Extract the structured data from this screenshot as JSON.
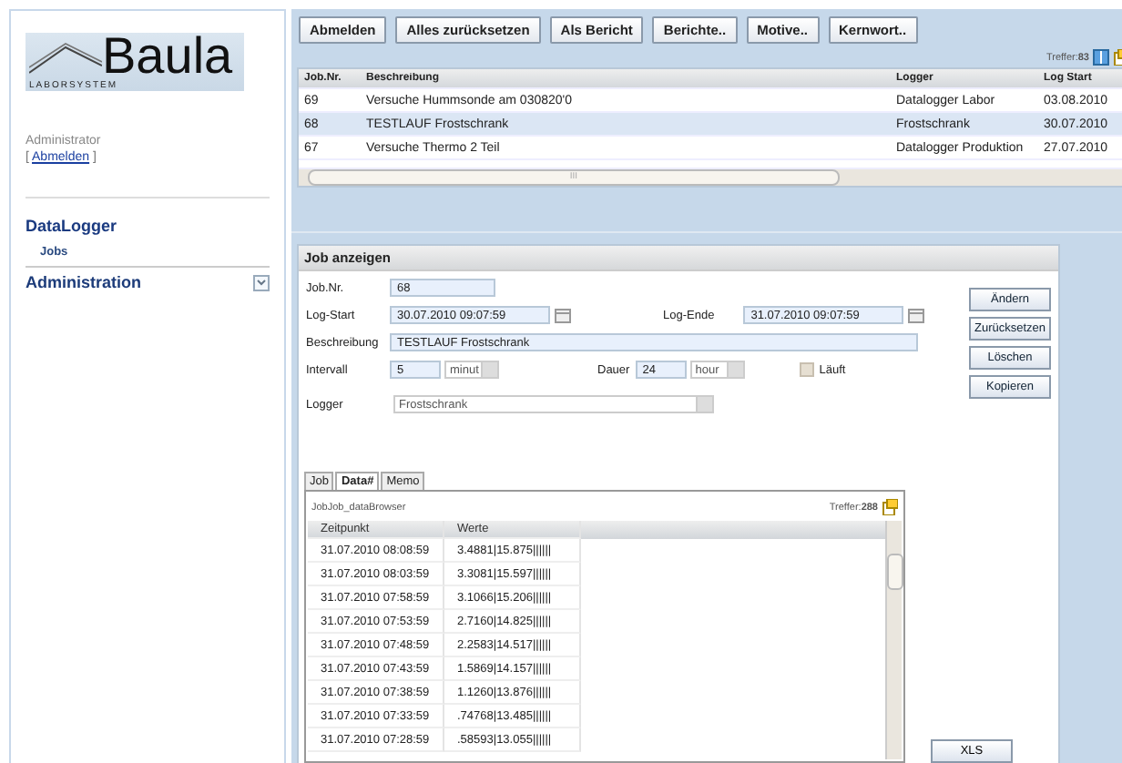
{
  "sidebar": {
    "logo": {
      "name": "Baula",
      "tagline": "LABORSYSTEM"
    },
    "user": "Administrator",
    "logout": {
      "open": "[",
      "link": "Abmelden",
      "close": "]"
    },
    "nav": [
      {
        "label": "DataLogger",
        "expanded": true,
        "children": [
          {
            "label": "Jobs"
          }
        ]
      },
      {
        "label": "Administration",
        "expanded": false
      }
    ]
  },
  "toolbar": {
    "buttons": [
      "Abmelden",
      "Alles zurücksetzen",
      "Als Bericht",
      "Berichte..",
      "Motive..",
      "Kernwort.."
    ]
  },
  "jobs": {
    "count": "Treffer:**83**",
    "columns": [
      "Job.Nr.",
      "Beschreibung",
      "Logger",
      "Log Start"
    ],
    "rows": [
      {
        "cells": [
          "69",
          "Versuche Hummsonde am 030820'0",
          "Datalogger Labor",
          "03.08.2010"
        ],
        "selected": false
      },
      {
        "cells": [
          "68",
          "TESTLAUF Frostschrank",
          "Frostschrank",
          "30.07.2010"
        ],
        "selected": true
      },
      {
        "cells": [
          "67",
          "Versuche Thermo 2 Teil",
          "Datalogger Produktion",
          "27.07.2010"
        ],
        "selected": false
      }
    ],
    "scroll_grip": "III"
  },
  "detail": {
    "title": "Job anzeigen",
    "job_nr": {
      "label": "Job.Nr.",
      "value": "68"
    },
    "log_start": {
      "label": "Log-Start",
      "value": "30.07.2010 09:07:59"
    },
    "log_end": {
      "label": "Log-Ende",
      "value": "31.07.2010 09:07:59"
    },
    "description": {
      "label": "Beschreibung",
      "value": "TESTLAUF Frostschrank"
    },
    "interval": {
      "label": "Intervall",
      "value": "5",
      "unit": "minut"
    },
    "duration": {
      "label": "Dauer",
      "value": "24",
      "unit": "hour"
    },
    "running": {
      "label": "Läuft",
      "checked": false
    },
    "logger": {
      "label": "Logger",
      "value": "Frostschrank"
    },
    "buttons": [
      "Ändern",
      "Zurücksetzen",
      "Löschen",
      "Kopieren"
    ],
    "tabs": [
      {
        "label": "Job",
        "selected": false
      },
      {
        "label": "Data#",
        "selected": true
      },
      {
        "label": "Memo",
        "selected": false
      }
    ],
    "browser": {
      "title": "JobJob_dataBrowser",
      "count": "Treffer:**288**",
      "columns": [
        "Zeitpunkt",
        "Werte"
      ],
      "rows": [
        [
          "31.07.2010 08:08:59",
          "3.4881|15.875||||||"
        ],
        [
          "31.07.2010 08:03:59",
          "3.3081|15.597||||||"
        ],
        [
          "31.07.2010 07:58:59",
          "3.1066|15.206||||||"
        ],
        [
          "31.07.2010 07:53:59",
          "2.7160|14.825||||||"
        ],
        [
          "31.07.2010 07:48:59",
          "2.2583|14.517||||||"
        ],
        [
          "31.07.2010 07:43:59",
          "1.5869|14.157||||||"
        ],
        [
          "31.07.2010 07:38:59",
          "1.1260|13.876||||||"
        ],
        [
          "31.07.2010 07:33:59",
          ".74768|13.485||||||"
        ],
        [
          "31.07.2010 07:28:59",
          ".58593|13.055||||||"
        ]
      ]
    },
    "export_button": "XLS"
  }
}
